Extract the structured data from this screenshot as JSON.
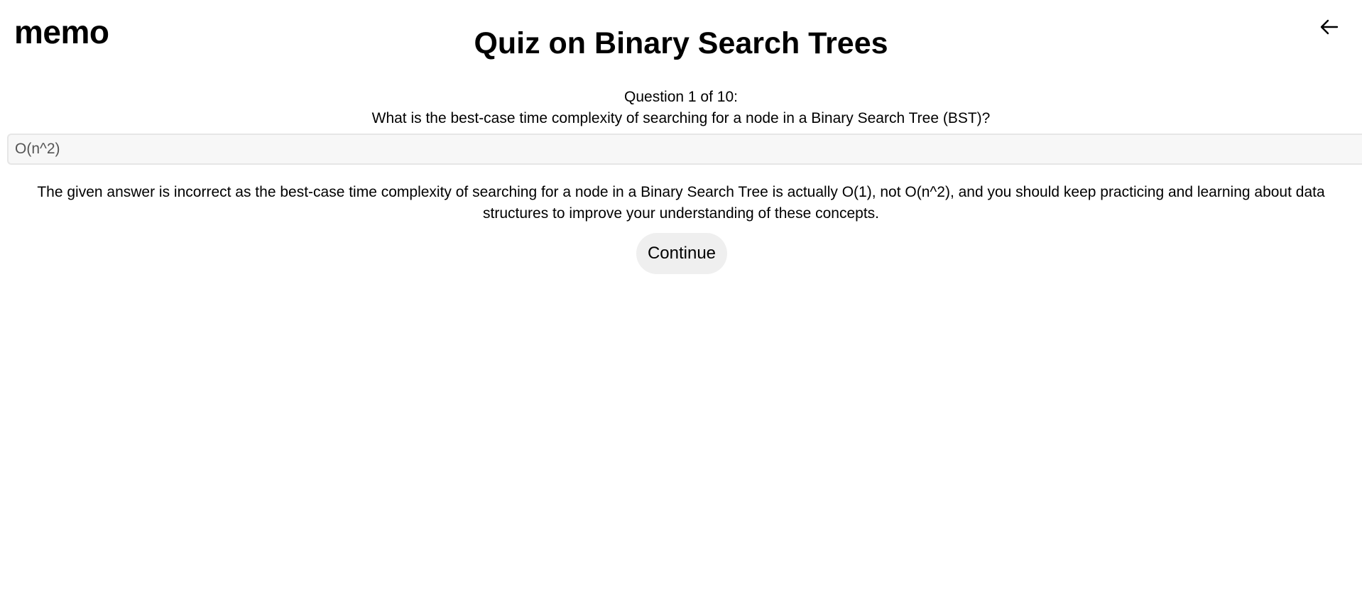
{
  "header": {
    "logo_text": "memo",
    "back_icon": "arrow-left-icon"
  },
  "quiz": {
    "title": "Quiz on Binary Search Trees",
    "progress_text": "Question 1 of 10:",
    "question_text": "What is the best-case time complexity of searching for a node in a Binary Search Tree (BST)?",
    "answer_value": "O(n^2)",
    "feedback_text": "The given answer is incorrect as the best-case time complexity of searching for a node in a Binary Search Tree is actually O(1), not O(n^2), and you should keep practicing and learning about data structures to improve your understanding of these concepts.",
    "continue_label": "Continue"
  }
}
